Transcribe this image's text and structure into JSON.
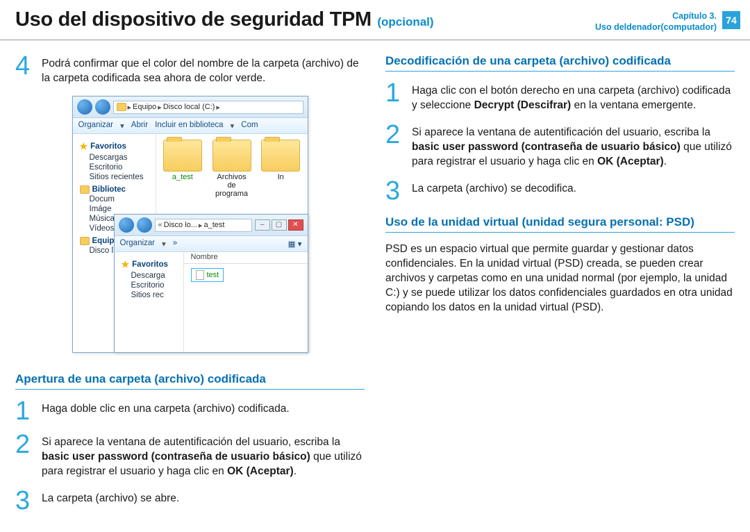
{
  "header": {
    "title": "Uso del dispositivo de seguridad TPM",
    "subtitle": "(opcional)",
    "chapter_label": "Capítulo 3.",
    "chapter_sub": "Uso deldenador(computador)",
    "page": "74"
  },
  "left": {
    "step4": "Podrá confirmar que el color del nombre de la carpeta (archivo) de la carpeta codificada sea ahora de color verde.",
    "section_open": "Apertura de una carpeta (archivo) codificada",
    "open_step1": "Haga doble clic en una carpeta (archivo) codificada.",
    "open_step2_pre": "Si aparece la ventana de autentificación del usuario, escriba la ",
    "open_step2_b1": "basic user password (contraseña de usuario básico)",
    "open_step2_mid": " que utilizó para registrar el usuario y haga clic en ",
    "open_step2_b2": "OK (Aceptar)",
    "open_step2_end": ".",
    "open_step3": "La carpeta (archivo) se abre."
  },
  "right": {
    "section_decode": "Decodificación de una carpeta (archivo) codificada",
    "dec_step1_pre": "Haga clic con el botón derecho en una carpeta (archivo) codificada y seleccione ",
    "dec_step1_b": "Decrypt (Descifrar)",
    "dec_step1_end": " en la ventana emergente.",
    "dec_step2_pre": "Si aparece la ventana de autentificación del usuario, escriba la ",
    "dec_step2_b1": "basic user password (contraseña de usuario básico)",
    "dec_step2_mid": " que utilizó para registrar el usuario y haga clic en ",
    "dec_step2_b2": "OK (Aceptar)",
    "dec_step2_end": ".",
    "dec_step3": "La carpeta (archivo) se decodifica.",
    "section_psd": "Uso de la unidad virtual (unidad segura personal: PSD)",
    "psd_body": "PSD es un espacio virtual que permite guardar y gestionar datos confidenciales. En la unidad virtual (PSD) creada, se pueden crear archivos y carpetas como en una unidad normal (por ejemplo, la unidad C:) y se puede utilizar los datos confidenciales guardados en otra unidad copiando los datos en la unidad virtual (PSD)."
  },
  "explorer": {
    "crumb1_a": "Equipo",
    "crumb1_b": "Disco local (C:)",
    "tb_org": "Organizar",
    "tb_open": "Abrir",
    "tb_incl": "Incluir en biblioteca",
    "tb_com": "Com",
    "fav": "Favoritos",
    "desc": "Descargas",
    "escr": "Escritorio",
    "sitios": "Sitios recientes",
    "bib": "Bibliotec",
    "docum": "Docum",
    "imag": "Imáge",
    "mus": "Música",
    "vid": "Vídeos",
    "equipo": "Equipo",
    "disco": "Disco l",
    "folder1": "a_test",
    "folder2": "Archivos de programa",
    "folder3": "In",
    "crumb2_a": "Disco lo...",
    "crumb2_b": "a_test",
    "tb2_org": "Organizar",
    "col_nombre": "Nombre",
    "file_test": "test",
    "fav2": "Favoritos",
    "desc2": "Descarga",
    "escr2": "Escritorio",
    "sitios2": "Sitios rec"
  }
}
